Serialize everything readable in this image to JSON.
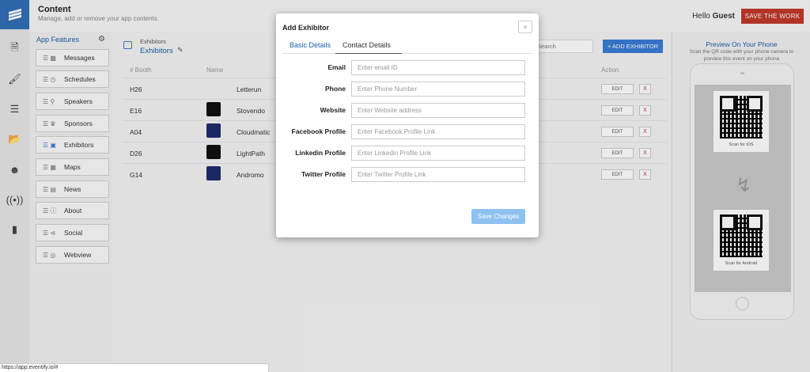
{
  "header": {
    "title": "Content",
    "subtitle": "Manage, add or remove your app contents.",
    "greeting": "Hello",
    "user": "Guest",
    "save_button": "SAVE THE WORK"
  },
  "rail": {
    "icons": [
      "document-icon",
      "brush-icon",
      "layers-icon",
      "folder-icon",
      "user-circle-icon",
      "broadcast-icon",
      "mobile-icon"
    ]
  },
  "features": {
    "heading": "App Features",
    "items": [
      {
        "label": "Messages",
        "icon": "chat-icon"
      },
      {
        "label": "Schedules",
        "icon": "clock-icon"
      },
      {
        "label": "Speakers",
        "icon": "microphone-icon"
      },
      {
        "label": "Sponsors",
        "icon": "crown-icon"
      },
      {
        "label": "Exhibitors",
        "icon": "exhibitor-icon"
      },
      {
        "label": "Maps",
        "icon": "map-icon"
      },
      {
        "label": "News",
        "icon": "news-icon"
      },
      {
        "label": "About",
        "icon": "info-icon"
      },
      {
        "label": "Social",
        "icon": "share-icon"
      },
      {
        "label": "Webview",
        "icon": "globe-icon"
      }
    ]
  },
  "list": {
    "breadcrumb": "Exhibitors",
    "title": "Exhibitors",
    "search_placeholder": "Search",
    "add_button": "+ ADD EXHIBITOR",
    "columns": {
      "booth": "# Booth",
      "name": "Name",
      "action": "Action"
    },
    "rows": [
      {
        "booth": "H26",
        "name": "Letterun"
      },
      {
        "booth": "E16",
        "name": "Stovendo"
      },
      {
        "booth": "A04",
        "name": "Cloudmatic"
      },
      {
        "booth": "D26",
        "name": "LightPath"
      },
      {
        "booth": "G14",
        "name": "Andromo"
      }
    ],
    "edit_label": "EDIT",
    "delete_label": "X"
  },
  "preview": {
    "title": "Preview On Your Phone",
    "subtitle": "Scan the QR code with your phone camera to preview this event on your phone",
    "ios_caption": "Scan for iOS",
    "android_caption": "Scan for Android"
  },
  "modal": {
    "title": "Add Exhibitor",
    "close": "×",
    "tabs": [
      "Basic Details",
      "Contact Details"
    ],
    "active_tab": "Contact Details",
    "fields": [
      {
        "label": "Email",
        "placeholder": "Enter email ID"
      },
      {
        "label": "Phone",
        "placeholder": "Enter Phone Number"
      },
      {
        "label": "Website",
        "placeholder": "Enter Website address"
      },
      {
        "label": "Facebook Profile",
        "placeholder": "Enter Facebook Profile Link"
      },
      {
        "label": "Linkedin Profile",
        "placeholder": "Enter Linkedin Profile Link"
      },
      {
        "label": "Twitter Profile",
        "placeholder": "Enter Twitter Profile Link"
      }
    ],
    "save_button": "Save Changes"
  },
  "status_url": "https://app.eventify.io/#",
  "colors": {
    "accent": "#1a5fa8",
    "danger": "#c0392b",
    "primary_button": "#3a7bd5"
  }
}
